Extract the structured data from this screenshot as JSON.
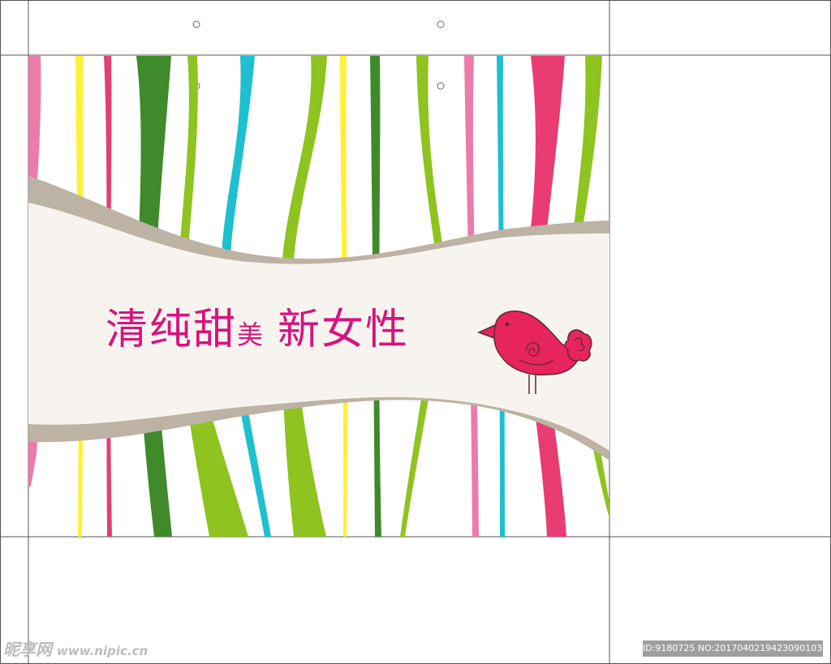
{
  "tagline": {
    "part1": "清纯甜",
    "part2": "美",
    "part3": "新女性",
    "color": "#d6147f"
  },
  "bird": {
    "icon": "bird-icon",
    "color": "#e8245d"
  },
  "watermark_left": {
    "site": "昵享网",
    "url": "www.nipic.cn"
  },
  "watermark_right": {
    "text": "ID:9180725 NO:20170402194230901039"
  },
  "colors": {
    "dark_green": "#3f8a2b",
    "lime": "#8fc31f",
    "yellow": "#fff03a",
    "pink": "#e74380",
    "light_pink": "#ec7bac",
    "cyan": "#1ec0cf",
    "band_fill": "#f7f4ef",
    "band_border": "#bcb3a4"
  }
}
